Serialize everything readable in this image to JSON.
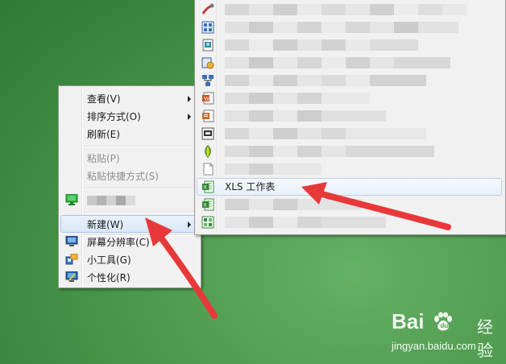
{
  "context_menu": {
    "items": [
      {
        "label": "查看(V)",
        "submenu": true
      },
      {
        "label": "排序方式(O)",
        "submenu": true
      },
      {
        "label": "刷新(E)"
      },
      {
        "label": "粘贴(P)",
        "disabled": true
      },
      {
        "label": "粘贴快捷方式(S)",
        "disabled": true
      },
      {
        "label": "",
        "pixelated": true,
        "icon": "monitor-green-icon"
      },
      {
        "label": "新建(W)",
        "submenu": true,
        "highlighted": true
      },
      {
        "label": "屏幕分辨率(C)",
        "icon": "display-resolution-icon"
      },
      {
        "label": "小工具(G)",
        "icon": "gadgets-icon"
      },
      {
        "label": "个性化(R)",
        "icon": "personalize-icon"
      }
    ]
  },
  "new_submenu": {
    "items": [
      {
        "icon": "shortcut-icon",
        "pixelated": true
      },
      {
        "icon": "contact-icon",
        "pixelated": true
      },
      {
        "icon": "image-document-icon",
        "pixelated": true
      },
      {
        "icon": "journal-icon",
        "pixelated": true
      },
      {
        "icon": "briefcase-network-icon",
        "pixelated": true
      },
      {
        "icon": "word-document-icon",
        "pixelated": true
      },
      {
        "icon": "rtf-document-icon",
        "pixelated": true
      },
      {
        "icon": "presentation-icon",
        "pixelated": true
      },
      {
        "icon": "photoshop-icon",
        "pixelated": true
      },
      {
        "icon": "text-document-icon",
        "pixelated": true
      },
      {
        "icon": "excel-icon",
        "label": "XLS 工作表",
        "highlighted": true
      },
      {
        "icon": "excel-icon",
        "pixelated": true
      },
      {
        "icon": "compressed-folder-icon",
        "pixelated": true
      }
    ]
  },
  "annotation_color": "#e8393a",
  "watermark": {
    "brand": "Bai",
    "brand_suffix": "u",
    "cn": "经验",
    "url": "jingyan.baidu.com"
  }
}
